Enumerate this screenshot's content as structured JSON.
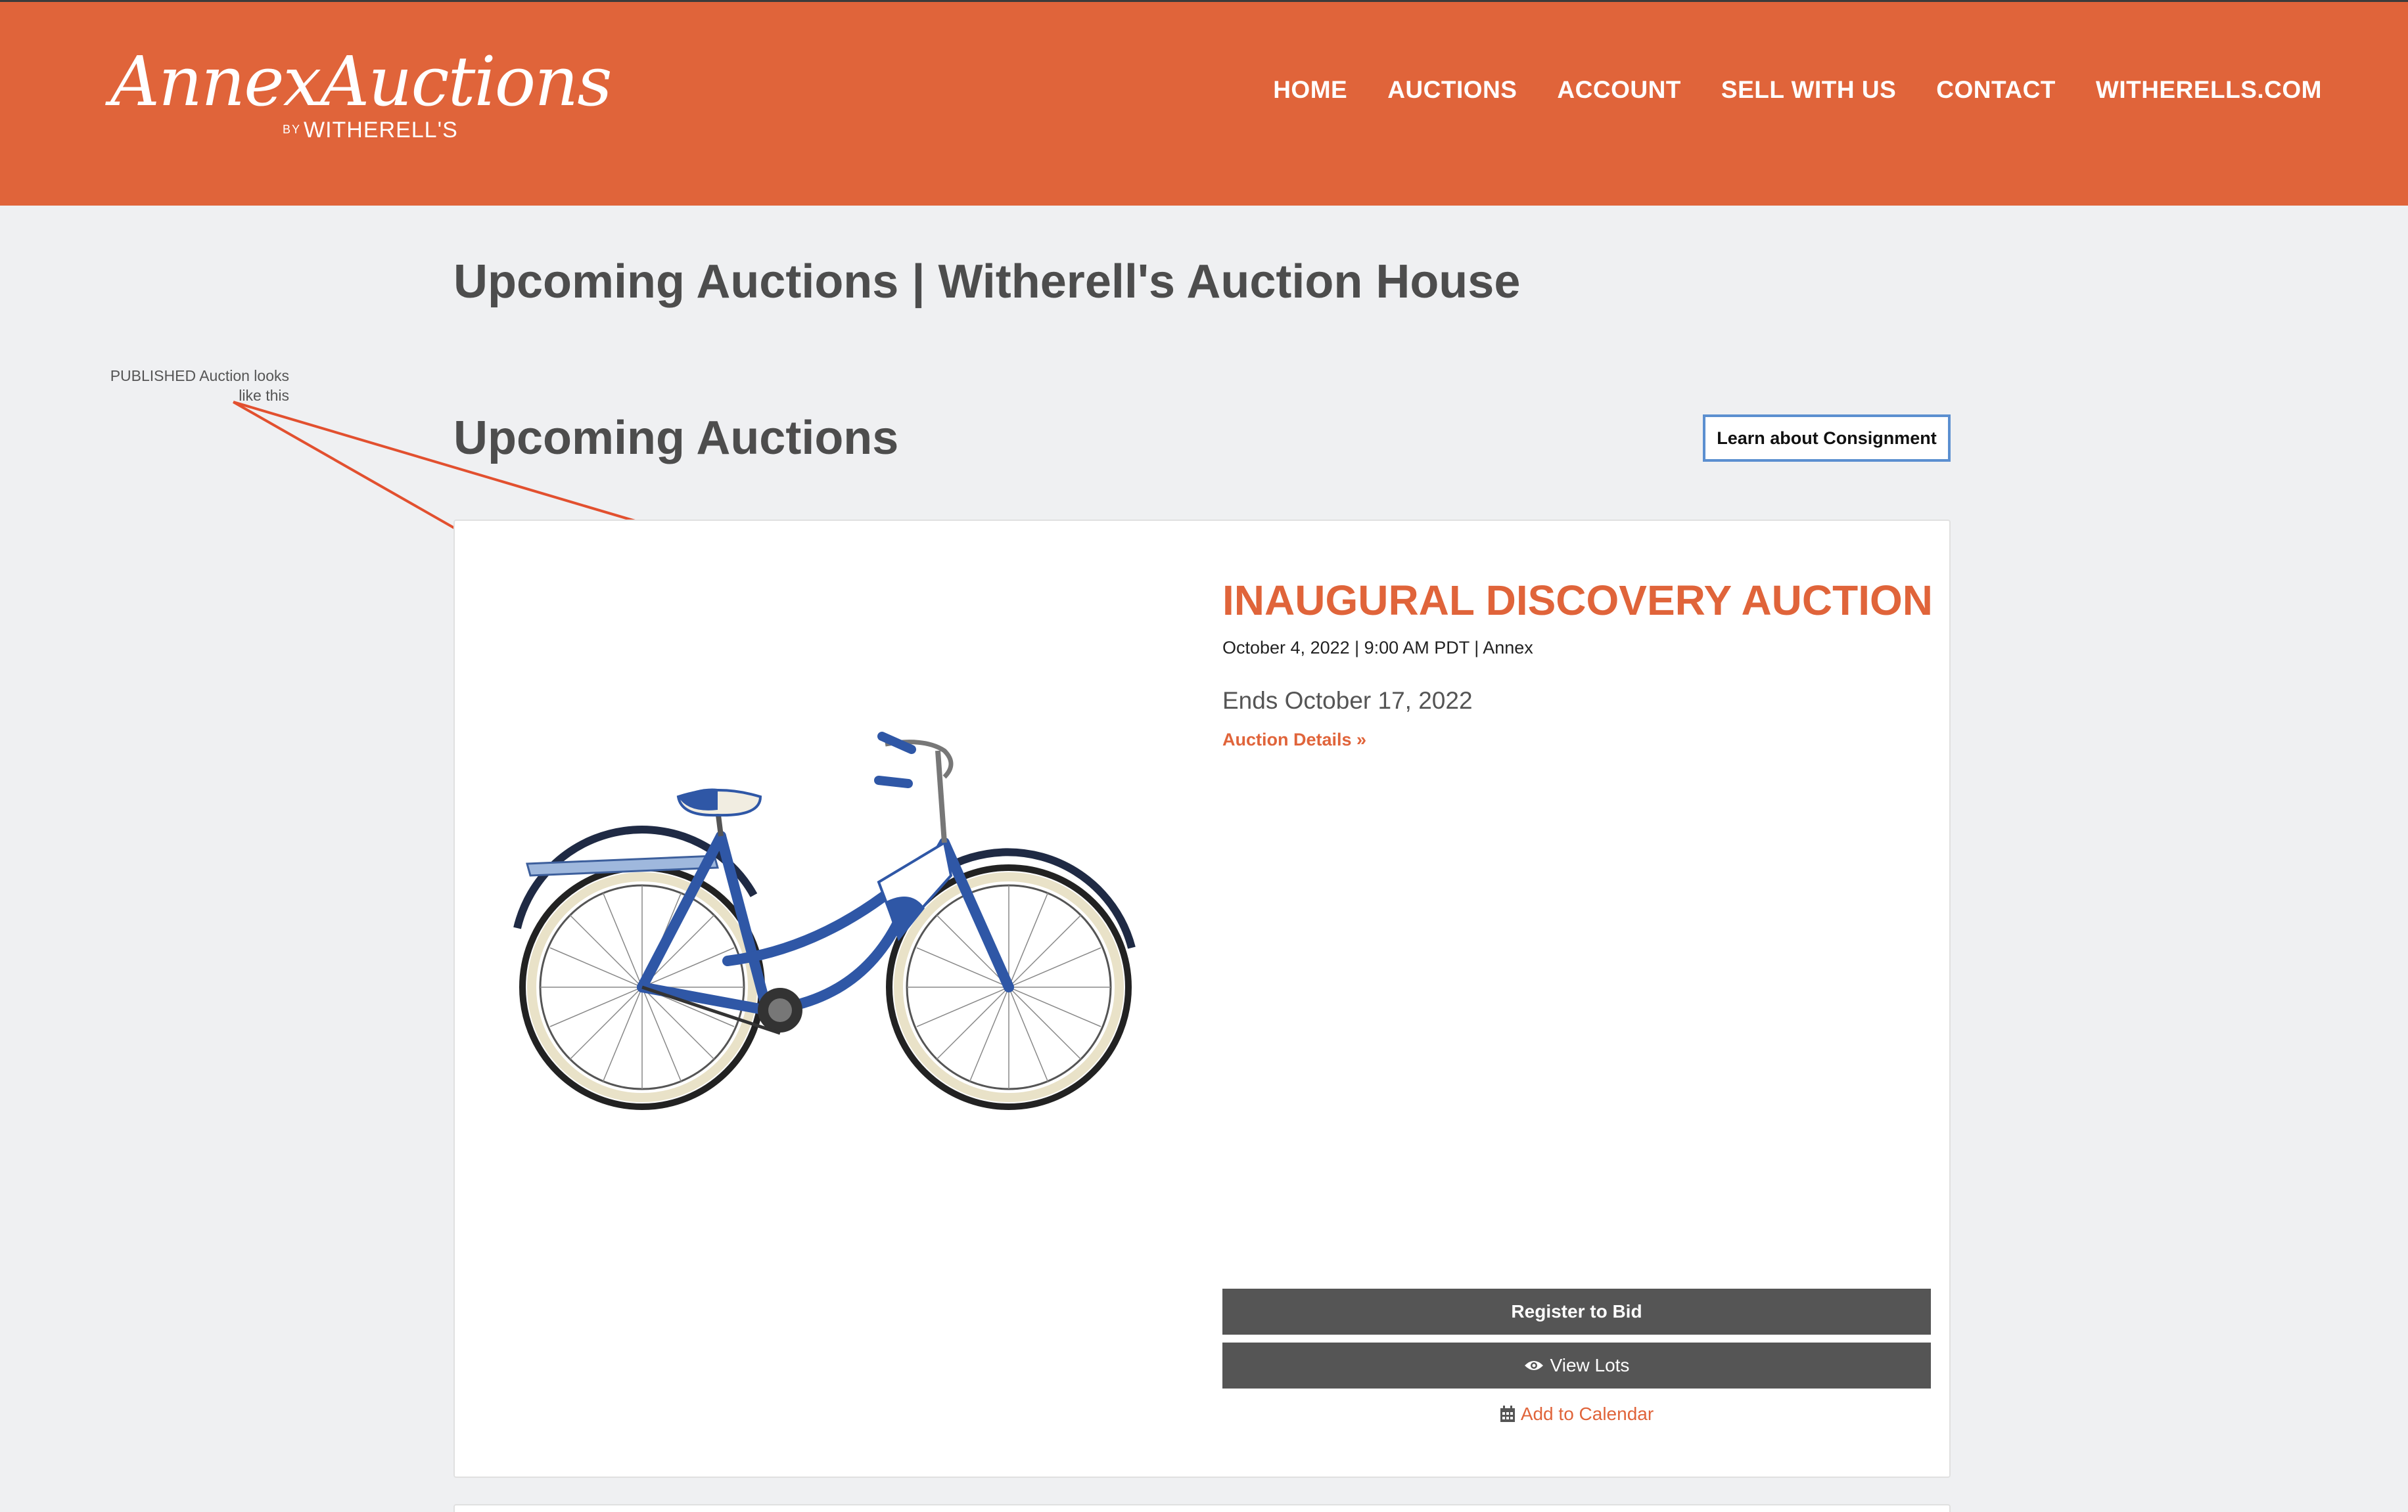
{
  "header": {
    "logo": {
      "script": "AnnexAuctions",
      "by": "BY",
      "brand": "WITHERELL'S"
    },
    "nav": [
      "HOME",
      "AUCTIONS",
      "ACCOUNT",
      "SELL WITH US",
      "CONTACT",
      "WITHERELLS.COM"
    ]
  },
  "page_title": "Upcoming Auctions | Witherell's Auction House",
  "section_title": "Upcoming Auctions",
  "consignment_button": "Learn about Consignment",
  "annotation": {
    "line1": "PUBLISHED Auction looks",
    "line2": "like this",
    "arrow_color": "#e2502f"
  },
  "auction": {
    "title": "INAUGURAL DISCOVERY AUCTION",
    "meta": "October 4, 2022 | 9:00 AM PDT | Annex",
    "ends": "Ends October 17, 2022",
    "details_link": "Auction Details »",
    "register_button": "Register to Bid",
    "view_lots_button": "View Lots",
    "calendar_link": "Add to Calendar",
    "image": "blue-white-cruiser-bicycle"
  },
  "colors": {
    "brand": "#e0643a",
    "button": "#555555",
    "background": "#eff0f2"
  }
}
